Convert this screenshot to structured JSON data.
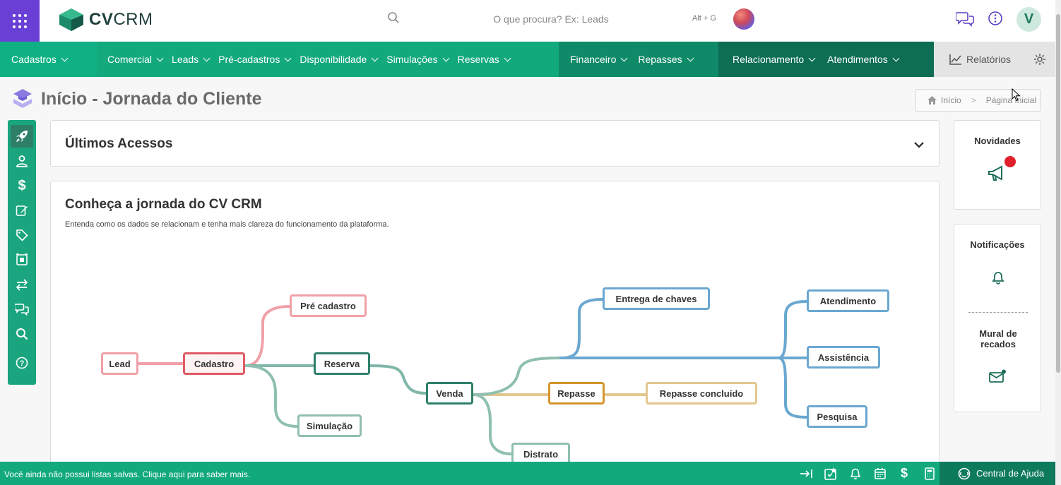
{
  "header": {
    "logo_text_bold": "CV",
    "logo_text": "CRM",
    "search_placeholder": "O que procura? Ex: Leads",
    "search_shortcut": "Alt + G",
    "avatar_initial": "V"
  },
  "nav": {
    "items_left": [
      "Cadastros"
    ],
    "items_mid": [
      "Comercial",
      "Leads",
      "Pré-cadastros",
      "Disponibilidade",
      "Simulações",
      "Reservas"
    ],
    "items_right": [
      "Financeiro",
      "Repasses"
    ],
    "items_far": [
      "Relacionamento",
      "Atendimentos"
    ],
    "reports_label": "Relatórios"
  },
  "page": {
    "title": "Início - Jornada do Cliente",
    "breadcrumb_home": "Início",
    "breadcrumb_current": "Página Inicial"
  },
  "recent": {
    "title": "Últimos Acessos"
  },
  "journey": {
    "title": "Conheça a jornada do CV CRM",
    "subtitle": "Entenda como os dados se relacionam e tenha mais clareza do funcionamento da plataforma.",
    "nodes": {
      "lead": "Lead",
      "cadastro": "Cadastro",
      "pre_cadastro": "Pré cadastro",
      "reserva": "Reserva",
      "simulacao": "Simulação",
      "venda": "Venda",
      "distrato": "Distrato",
      "repasse": "Repasse",
      "repasse_concluido": "Repasse concluído",
      "entrega_chaves": "Entrega de chaves",
      "atendimento": "Atendimento",
      "assistencia": "Assistência",
      "pesquisa": "Pesquisa"
    }
  },
  "sidebar_right": {
    "novidades": "Novidades",
    "notificacoes": "Notificações",
    "mural": "Mural de recados"
  },
  "footer": {
    "message": "Você ainda não possui listas salvas. Clique aqui para saber mais.",
    "help_label": "Central de Ajuda"
  },
  "colors": {
    "brand_purple": "#6a3fd6",
    "brand_green": "#12a97d",
    "nav_dark": "#0f6b52",
    "notification_dot": "#e0202a"
  }
}
